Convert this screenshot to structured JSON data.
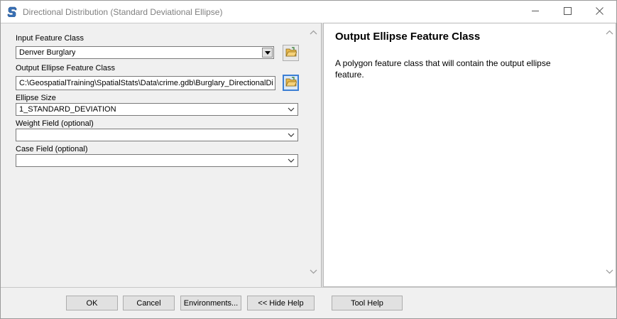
{
  "window": {
    "title": "Directional Distribution (Standard Deviational Ellipse)",
    "app_icon": "toolbox-script-icon",
    "controls": [
      "minimize-icon",
      "maximize-icon",
      "close-icon"
    ]
  },
  "form": {
    "input_feature_class": {
      "label": "Input Feature Class",
      "value": "Denver Burglary"
    },
    "output_ellipse": {
      "label": "Output Ellipse Feature Class",
      "value": "C:\\GeospatialTraining\\SpatialStats\\Data\\crime.gdb\\Burglary_DirectionalDist"
    },
    "ellipse_size": {
      "label": "Ellipse Size",
      "value": "1_STANDARD_DEVIATION"
    },
    "weight_field": {
      "label": "Weight Field (optional)",
      "value": ""
    },
    "case_field": {
      "label": "Case Field (optional)",
      "value": ""
    }
  },
  "help": {
    "title": "Output Ellipse Feature Class",
    "description": "A polygon feature class that will contain the output ellipse feature."
  },
  "buttons": {
    "ok": "OK",
    "cancel": "Cancel",
    "environments": "Environments...",
    "hide_help": "<< Hide Help",
    "tool_help": "Tool Help"
  },
  "colors": {
    "accent": "#3c7fd4",
    "panel": "#f0f0f0"
  }
}
